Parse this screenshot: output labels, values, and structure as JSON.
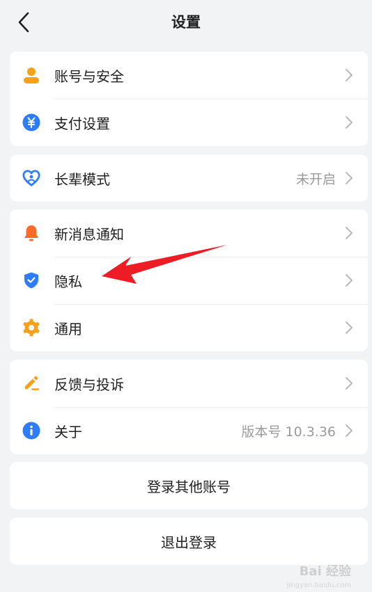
{
  "header": {
    "title": "设置"
  },
  "groups": [
    {
      "items": [
        {
          "label": "账号与安全",
          "icon": "user-icon",
          "value": ""
        },
        {
          "label": "支付设置",
          "icon": "yuan-icon",
          "value": ""
        }
      ]
    },
    {
      "items": [
        {
          "label": "长辈模式",
          "icon": "heart-icon",
          "value": "未开启"
        }
      ]
    },
    {
      "items": [
        {
          "label": "新消息通知",
          "icon": "bell-icon",
          "value": ""
        },
        {
          "label": "隐私",
          "icon": "shield-icon",
          "value": ""
        },
        {
          "label": "通用",
          "icon": "gear-icon",
          "value": ""
        }
      ]
    },
    {
      "items": [
        {
          "label": "反馈与投诉",
          "icon": "pencil-icon",
          "value": ""
        },
        {
          "label": "关于",
          "icon": "info-icon",
          "value": "版本号 10.3.36"
        }
      ]
    }
  ],
  "buttons": {
    "switch_account": "登录其他账号",
    "logout": "退出登录"
  },
  "watermark": {
    "text": "Bai 经验",
    "sub": "jingyan.baidu.com"
  },
  "colors": {
    "background": "#f2f3f5",
    "card": "#ffffff",
    "orange": "#f7a11a",
    "blue": "#2f7df6",
    "red_orange": "#ff6a2b",
    "annotation_red": "#ee1c25"
  }
}
